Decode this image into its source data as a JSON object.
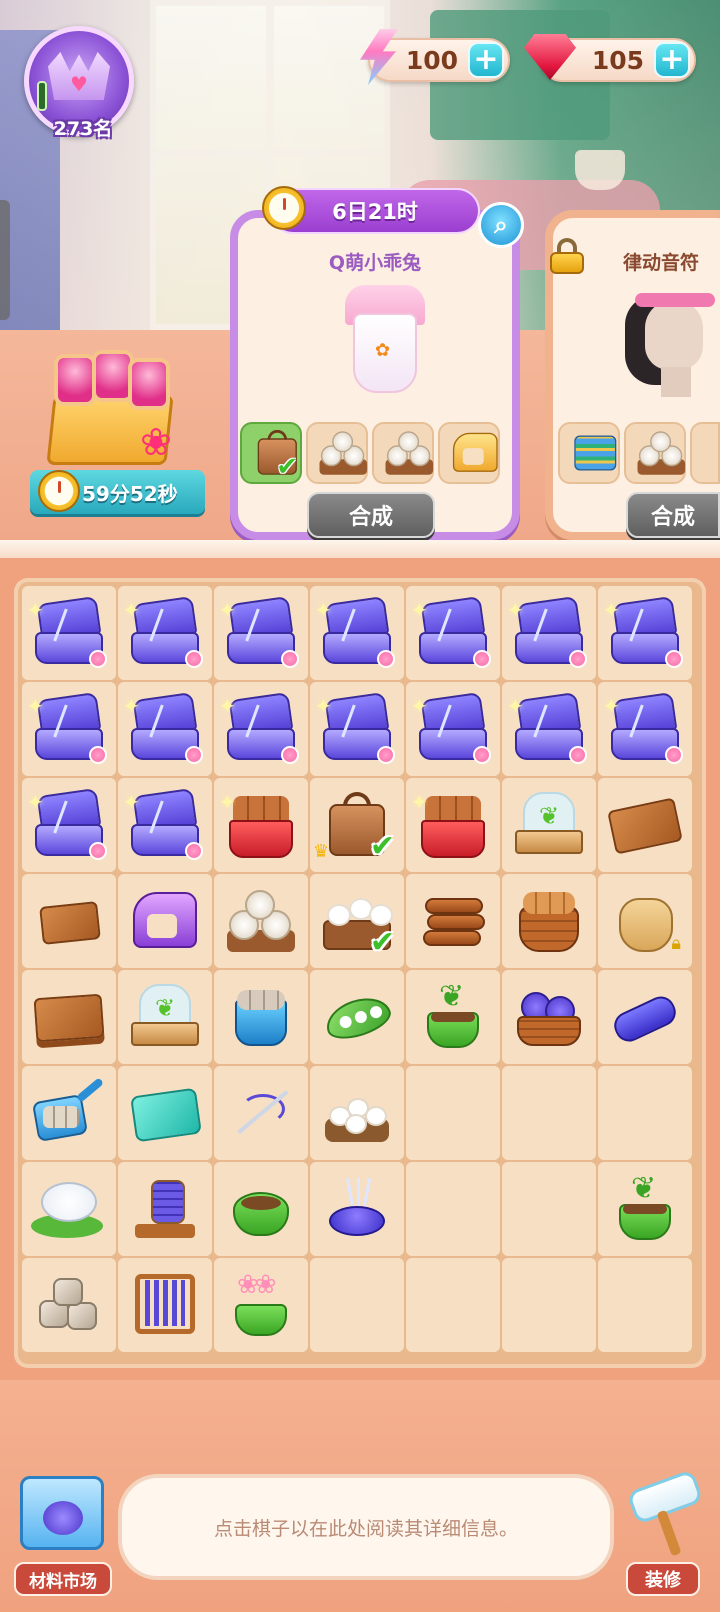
{
  "hud": {
    "rank": "273名",
    "energy": "100",
    "gems": "105",
    "colors": {
      "energy": "#ff7ac1",
      "gem": "#e3173f",
      "plus": "#22b6cf"
    }
  },
  "gift": {
    "timer": "59分52秒"
  },
  "orders": [
    {
      "timer": "6日21时",
      "title": "Q萌小乖兔",
      "button": "合成",
      "requirements": [
        {
          "icon": "leather-bag-icon",
          "done": true
        },
        {
          "icon": "towel-tray-icon",
          "done": false
        },
        {
          "icon": "towel-tray-icon",
          "done": false
        },
        {
          "icon": "sewing-machine-icon",
          "done": false
        }
      ]
    },
    {
      "title": "律动音符",
      "button": "合成",
      "locked": true,
      "requirements": [
        {
          "icon": "fabric-box-icon",
          "done": false
        },
        {
          "icon": "towel-tray-icon",
          "done": false
        },
        {
          "icon": "towel-tray-icon",
          "done": false
        }
      ]
    }
  ],
  "board": {
    "rows": [
      [
        "sewing-box",
        "sewing-box",
        "sewing-box",
        "sewing-box",
        "sewing-box",
        "sewing-box",
        "sewing-box"
      ],
      [
        "sewing-box",
        "sewing-box",
        "sewing-box",
        "sewing-box",
        "sewing-box",
        "sewing-box",
        "sewing-box"
      ],
      [
        "sewing-box",
        "sewing-box",
        "wood-basket-red",
        "leather-bag",
        "wood-basket-red",
        "seedling-box",
        "leather-sheet"
      ],
      [
        "leather-scrap",
        "sewing-machine",
        "towel-tray",
        "cotton-box",
        "wood-stack",
        "wood-basket",
        "grain-sack"
      ],
      [
        "leather-stack",
        "seedling-box",
        "stone-bucket",
        "cotton-pod",
        "sprout-pot",
        "yarn-basket",
        "thread-roll"
      ],
      [
        "stone-scoop",
        "teal-fabric",
        "needle-thread",
        "cotton-pile",
        "",
        "",
        ""
      ],
      [
        "silk-cocoon",
        "thread-spindle",
        "soil-pot",
        "pincushion",
        "",
        "",
        "sprout-pot"
      ],
      [
        "stone-pile",
        "loom",
        "flower-pot",
        "",
        "",
        "",
        ""
      ]
    ]
  },
  "footer": {
    "info_text": "点击棋子以在此处阅读其详细信息。",
    "market_label": "材料市场",
    "decorate_label": "装修"
  }
}
